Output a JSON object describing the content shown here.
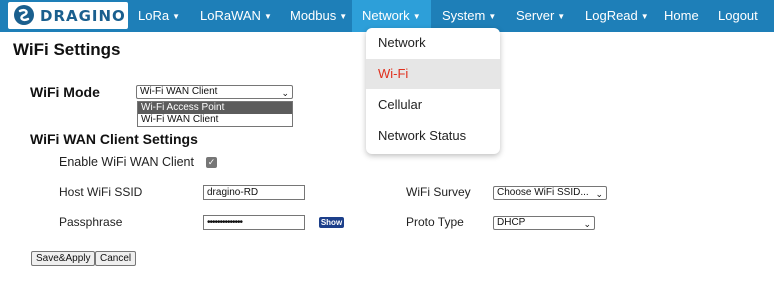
{
  "brand": {
    "name": "DRAGINO",
    "logo_icon": "dragino-logo-icon"
  },
  "nav": {
    "items": [
      {
        "label": "LoRa",
        "caret": "▼"
      },
      {
        "label": "LoRaWAN",
        "caret": "▼"
      },
      {
        "label": "Modbus",
        "caret": "▼"
      },
      {
        "label": "Network",
        "caret": "▼"
      },
      {
        "label": "System",
        "caret": "▼"
      },
      {
        "label": "Server",
        "caret": "▼"
      },
      {
        "label": "LogRead",
        "caret": "▼"
      },
      {
        "label": "Home",
        "caret": ""
      },
      {
        "label": "Logout",
        "caret": ""
      }
    ],
    "active": "Network",
    "dropdown": [
      "Network",
      "Wi-Fi",
      "Cellular",
      "Network Status"
    ],
    "dropdown_selected": "Wi-Fi"
  },
  "page": {
    "title": "WiFi Settings",
    "wifi_mode": {
      "label": "WiFi Mode",
      "value": "Wi-Fi WAN Client",
      "options": [
        "Wi-Fi Access Point",
        "Wi-Fi WAN Client"
      ],
      "highlighted": "Wi-Fi Access Point"
    },
    "client_settings": {
      "heading": "WiFi WAN Client Settings",
      "enable_label": "Enable WiFi WAN Client",
      "enable_checked": true,
      "ssid_label": "Host WiFi SSID",
      "ssid_value": "dragino-RD",
      "passphrase_label": "Passphrase",
      "passphrase_value": "••••••••••••••",
      "show_label": "Show",
      "survey_label": "WiFi Survey",
      "survey_value": "Choose WiFi SSID...",
      "proto_label": "Proto Type",
      "proto_value": "DHCP"
    },
    "buttons": {
      "save_apply": "Save&Apply",
      "cancel": "Cancel"
    }
  },
  "colors": {
    "navbar": "#1e7fb8",
    "nav_active": "#2d9fd9",
    "dropdown_selected_text": "#e0301e",
    "show_button": "#1c3f8a"
  }
}
